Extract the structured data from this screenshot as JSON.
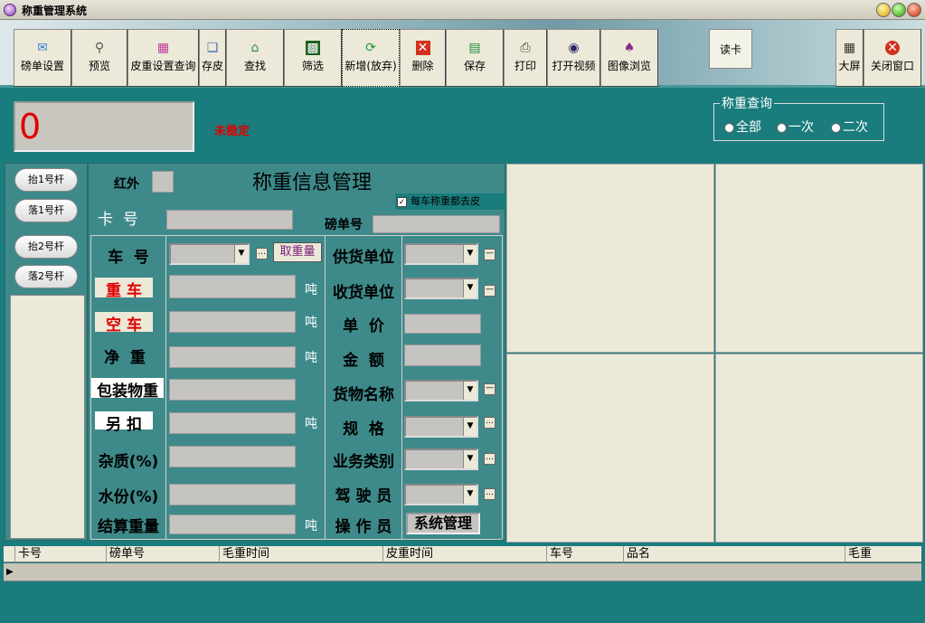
{
  "window": {
    "title": "称重管理系统"
  },
  "toolbar": {
    "buttons": [
      {
        "label": "磅单设置",
        "icon": "settings-chat-icon"
      },
      {
        "label": "预览",
        "icon": "magnifier-icon"
      },
      {
        "label": "皮重设置查询",
        "icon": "table-query-icon"
      },
      {
        "label": "存皮",
        "icon": "book-icon"
      },
      {
        "label": "查找",
        "icon": "house-search-icon"
      },
      {
        "label": "筛选",
        "icon": "filter-icon"
      },
      {
        "label": "新增(放弃)",
        "icon": "refresh-add-icon"
      },
      {
        "label": "删除",
        "icon": "delete-x-icon"
      },
      {
        "label": "保存",
        "icon": "save-disk-icon"
      },
      {
        "label": "打印",
        "icon": "printer-icon"
      },
      {
        "label": "打开视频",
        "icon": "video-camera-icon"
      },
      {
        "label": "图像浏览",
        "icon": "image-browse-icon"
      }
    ],
    "read_card": "读卡",
    "right_buttons": [
      {
        "label": "大屏",
        "icon": "grid-screen-icon"
      },
      {
        "label": "关闭窗口",
        "icon": "close-circle-icon"
      }
    ]
  },
  "status": {
    "weight": "0",
    "stability": "未稳定"
  },
  "query": {
    "legend": "称重查询",
    "options": [
      "全部",
      "一次",
      "二次"
    ]
  },
  "side": {
    "buttons": [
      "抬1号杆",
      "落1号杆",
      "抬2号杆",
      "落2号杆"
    ]
  },
  "info": {
    "infrared_label": "红外",
    "heading": "称重信息管理",
    "tare_checkbox": "每车称重都去皮",
    "card_no_label": "卡  号",
    "ticket_no_label": "磅单号",
    "left_fields": [
      {
        "label": "车  号",
        "unit": ""
      },
      {
        "label": "重 车",
        "unit": "吨"
      },
      {
        "label": "空 车",
        "unit": "吨"
      },
      {
        "label": "净  重",
        "unit": "吨"
      },
      {
        "label": "包装物重",
        "unit": ""
      },
      {
        "label": "另 扣",
        "unit": "吨"
      },
      {
        "label": "杂质(%)",
        "unit": ""
      },
      {
        "label": "水份(%)",
        "unit": ""
      },
      {
        "label": "结算重量",
        "unit": "吨"
      }
    ],
    "take_weight": "取重量",
    "right_fields": [
      {
        "label": "供货单位"
      },
      {
        "label": "收货单位"
      },
      {
        "label": "单  价"
      },
      {
        "label": "金  额"
      },
      {
        "label": "货物名称"
      },
      {
        "label": "规  格"
      },
      {
        "label": "业务类别"
      },
      {
        "label": "驾 驶 员"
      },
      {
        "label": "操 作 员"
      }
    ],
    "operator_value": "系统管理"
  },
  "table": {
    "columns": [
      "卡号",
      "磅单号",
      "毛重时间",
      "皮重时间",
      "车号",
      "品名",
      "毛重"
    ]
  },
  "colors": {
    "accent": "#1a7c7c",
    "alert": "#e00000"
  }
}
